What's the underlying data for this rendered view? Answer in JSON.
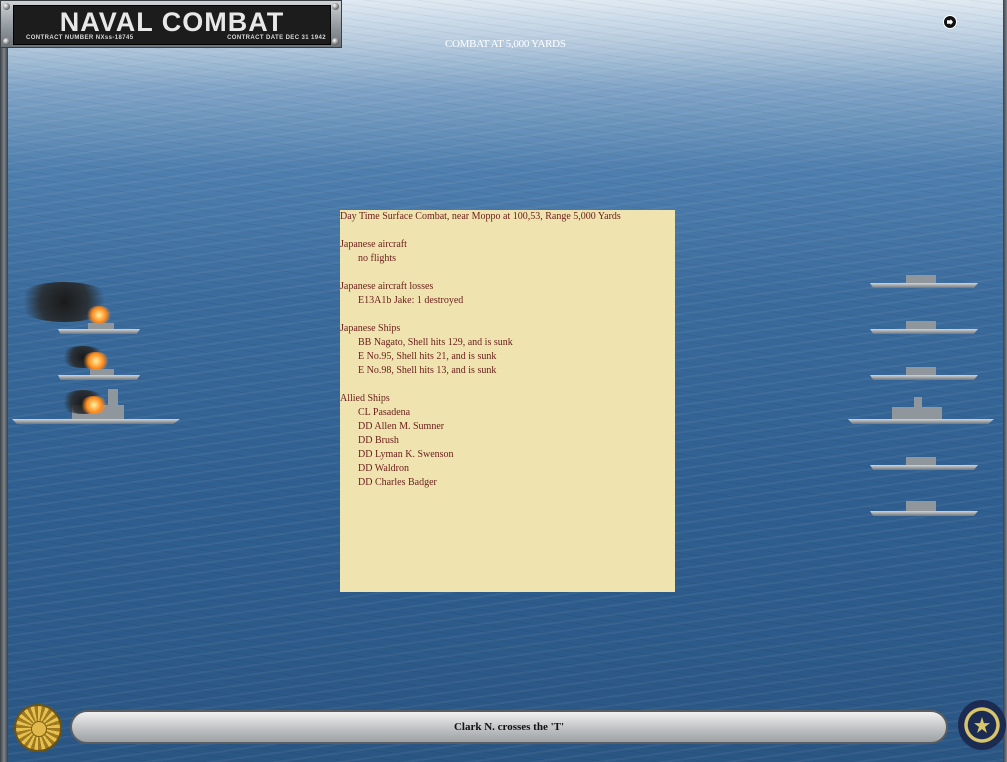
{
  "header": {
    "title": "NAVAL COMBAT",
    "contract_number_label": "CONTRACT NUMBER",
    "contract_number": "NXss-18745",
    "contract_date_label": "CONTRACT DATE",
    "contract_date": "DEC 31 1942"
  },
  "combat_range": "COMBAT AT 5,000 YARDS",
  "report": {
    "headline": "Day Time Surface Combat, near Moppo at 100,53, Range 5,000 Yards",
    "sections": [
      {
        "heading": "Japanese aircraft",
        "items": [
          "no flights"
        ]
      },
      {
        "heading": "Japanese aircraft losses",
        "items": [
          "E13A1b Jake: 1 destroyed"
        ]
      },
      {
        "heading": "Japanese Ships",
        "items": [
          "BB Nagato, Shell hits 129, and is sunk",
          "E No.95, Shell hits 21, and is sunk",
          "E No.98, Shell hits 13, and is sunk"
        ]
      },
      {
        "heading": "Allied Ships",
        "items": [
          "CL Pasadena",
          "DD Allen M. Sumner",
          "DD Brush",
          "DD Lyman K. Swenson",
          "DD Waldron",
          "DD Charles Badger"
        ]
      }
    ]
  },
  "status": "Clark N. crosses the 'T'",
  "icons": {
    "left_emblem": "chrysanthemum-emblem-icon",
    "right_emblem": "navy-seal-icon",
    "nav": "arrow-circle-icon"
  },
  "colors": {
    "report_bg": "#efe3b0",
    "report_text": "#6a1e1a",
    "sea": "#2f5f90"
  }
}
